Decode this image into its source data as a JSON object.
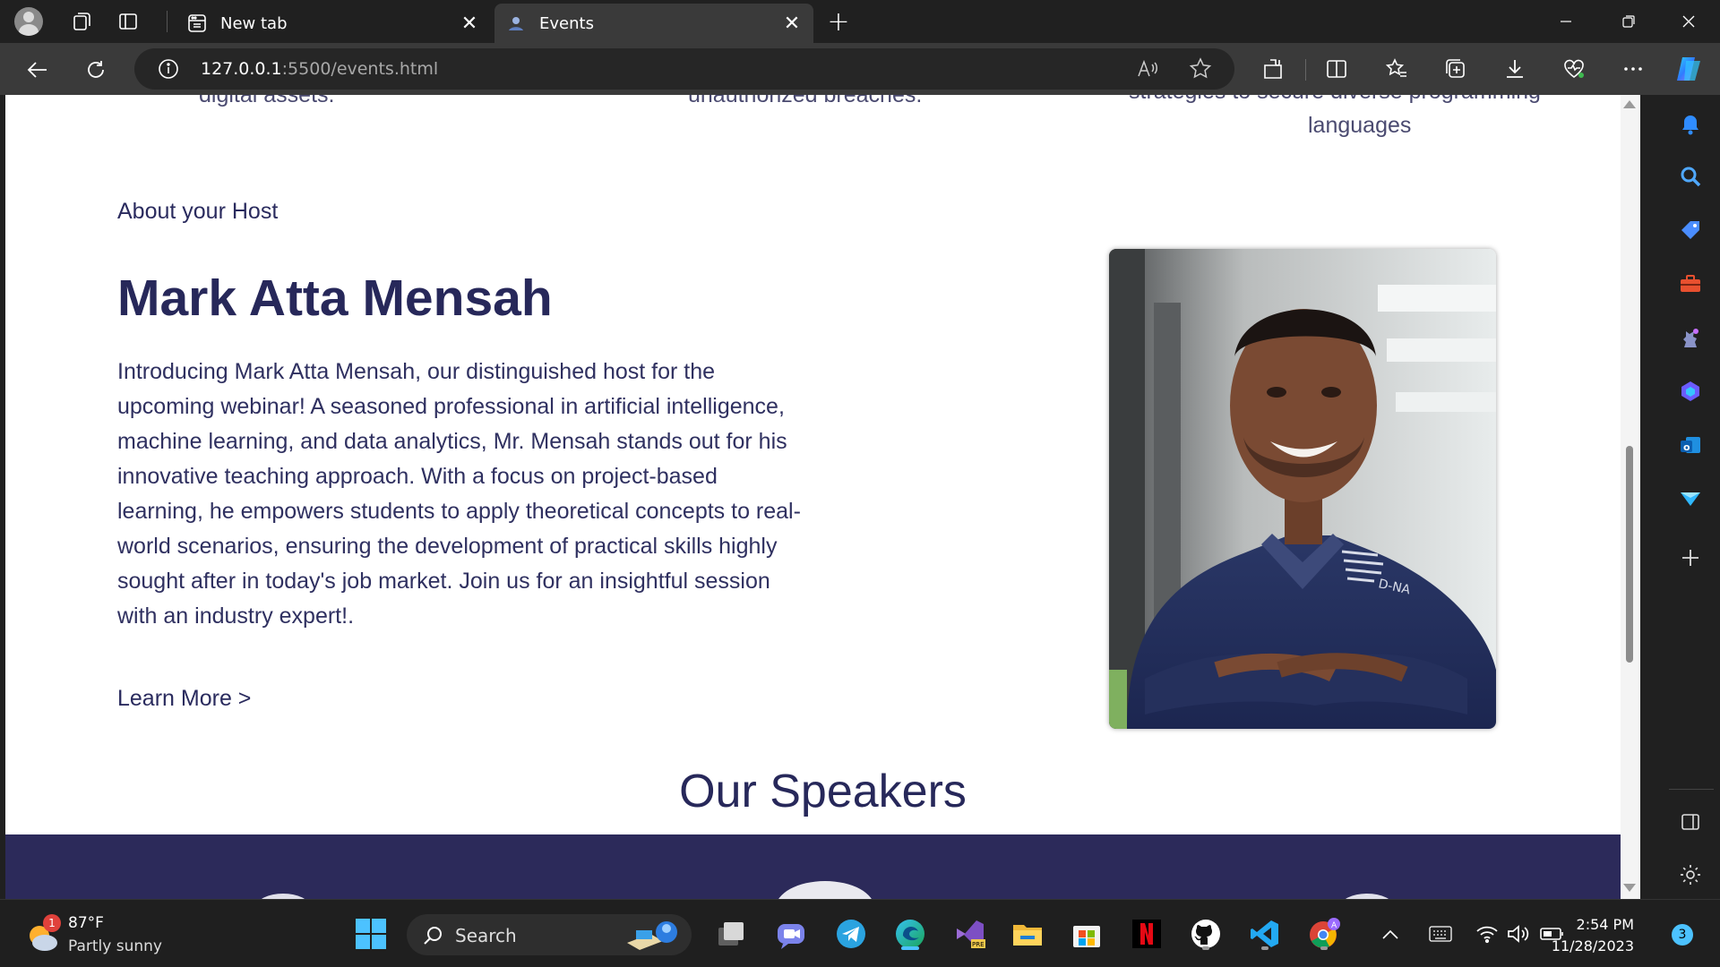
{
  "browser": {
    "tabs": [
      {
        "title": "New tab",
        "active": false
      },
      {
        "title": "Events",
        "active": true
      }
    ],
    "url": {
      "host": "127.0.0.1",
      "path": ":5500/events.html"
    }
  },
  "page": {
    "prev_section": {
      "col1": "digital assets.",
      "col2": "unauthorized breaches.",
      "col3_line1": "strategies to secure diverse programming",
      "col3_line2": "languages"
    },
    "about_label": "About your Host",
    "host_name": "Mark Atta Mensah",
    "host_bio": "Introducing Mark Atta Mensah, our distinguished host for the upcoming webinar! A seasoned professional in artificial intelligence, machine learning, and data analytics, Mr. Mensah stands out for his innovative teaching approach. With a focus on project-based learning, he empowers students to apply theoretical concepts to real-world scenarios, ensuring the development of practical skills highly sought after in today's job market. Join us for an insightful session with an industry expert!.",
    "learn_more": "Learn More >",
    "speakers_title": "Our Speakers",
    "photo_shirt_text": "D-NA"
  },
  "taskbar": {
    "weather_temp": "87°F",
    "weather_desc": "Partly sunny",
    "weather_badge": "1",
    "search_label": "Search",
    "time": "2:54 PM",
    "date": "11/28/2023",
    "notifications": "3"
  },
  "colors": {
    "brand_navy": "#27285a",
    "band": "#2c2a5a",
    "edge_accent": "#4cc2ff"
  }
}
